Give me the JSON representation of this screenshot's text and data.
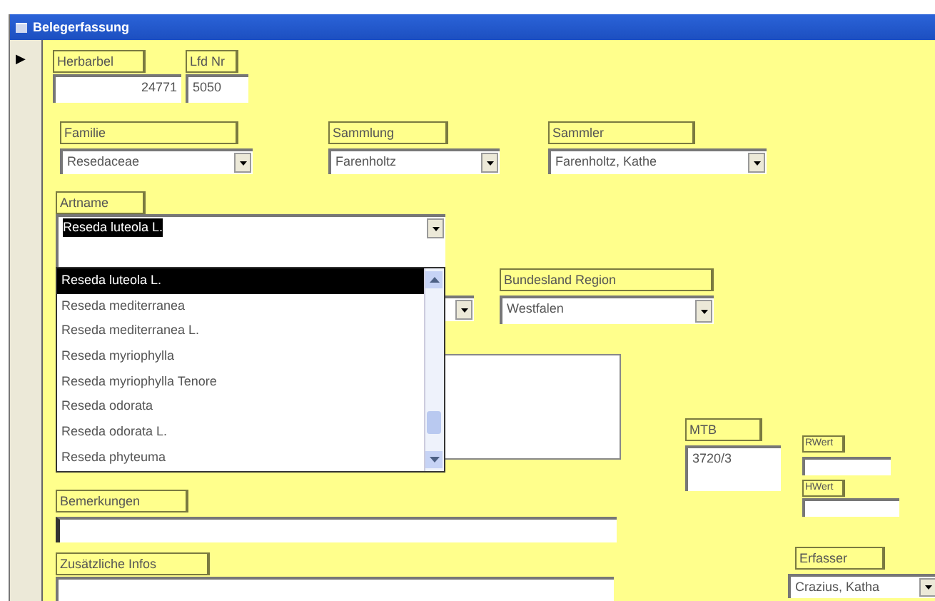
{
  "window": {
    "title": "Belegerfassung"
  },
  "record_selector": {
    "current": "▶"
  },
  "controls": [
    {
      "kind": "textbox",
      "label": "Herbarbel",
      "value": "24771"
    },
    {
      "kind": "textbox",
      "label": "Lfd Nr",
      "value": "5050"
    },
    {
      "kind": "combo",
      "label": "Familie",
      "value": "Resedaceae"
    },
    {
      "kind": "combo",
      "label": "Sammlung",
      "value": "Farenholtz"
    },
    {
      "kind": "combo",
      "label": "Sammler",
      "value": "Farenholtz, Kathe"
    },
    {
      "kind": "combo",
      "label": "Bundesland Region",
      "value": "Westfalen"
    },
    {
      "kind": "memo"
    },
    {
      "kind": "textbox",
      "label": "MTB",
      "value": "3720/3"
    },
    {
      "kind": "textbox",
      "label": "RWert"
    },
    {
      "kind": "textbox",
      "label": "HWert"
    },
    {
      "kind": "textbox",
      "label": "Bemerkungen",
      "focused": true
    },
    {
      "kind": "textbox",
      "label": "Zusätzliche Infos"
    },
    {
      "kind": "combo",
      "label": "Erfasser",
      "value": "Crazius, Katha"
    },
    {
      "kind": "combo_hidden"
    }
  ],
  "artname": {
    "label": "Artname",
    "value": "Reseda luteola L.",
    "text_selected": true,
    "options": [
      {
        "text": "Reseda luteola L.",
        "selected": true
      },
      {
        "text": "Reseda mediterranea",
        "selected": false
      },
      {
        "text": "Reseda mediterranea L.",
        "selected": false
      },
      {
        "text": "Reseda myriophylla",
        "selected": false
      },
      {
        "text": "Reseda myriophylla Tenore",
        "selected": false
      },
      {
        "text": "Reseda odorata",
        "selected": false
      },
      {
        "text": "Reseda odorata L.",
        "selected": false
      },
      {
        "text": "Reseda phyteuma",
        "selected": false
      }
    ]
  }
}
